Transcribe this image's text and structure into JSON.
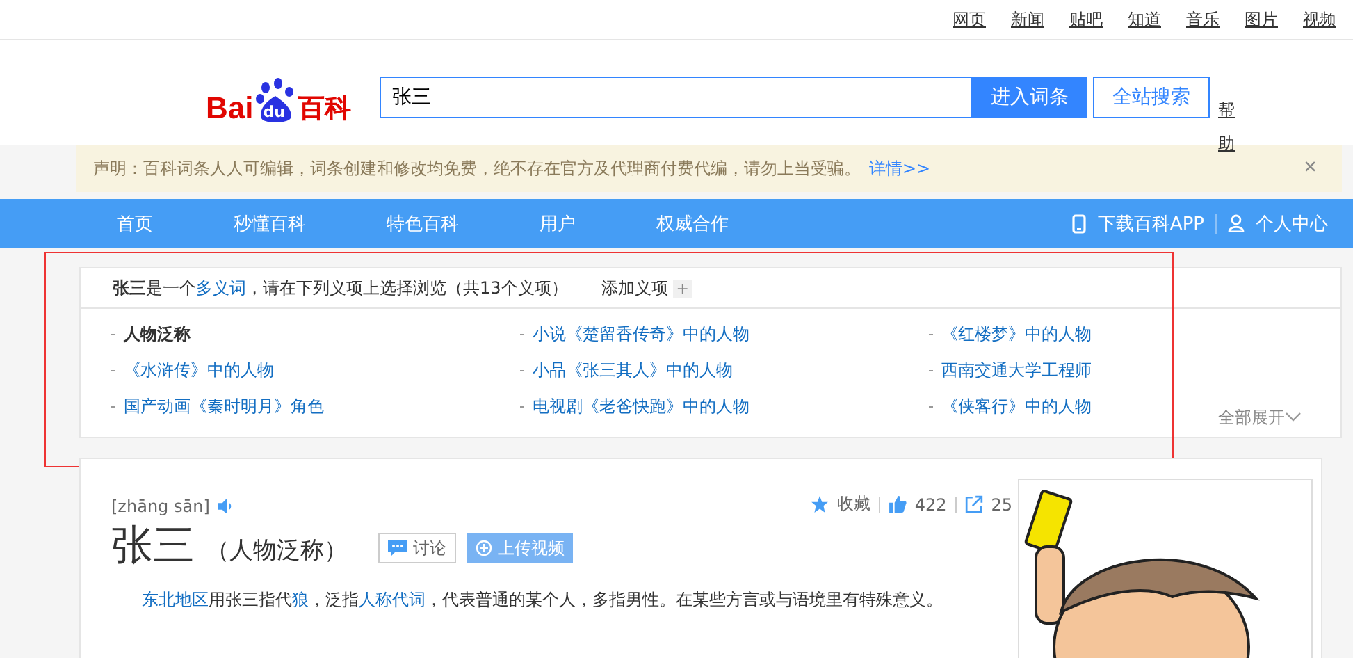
{
  "top_links": [
    "网页",
    "新闻",
    "贴吧",
    "知道",
    "音乐",
    "图片",
    "视频"
  ],
  "logo": {
    "left": "Bai",
    "badge": "du",
    "right": "百科"
  },
  "search": {
    "value": "张三",
    "enter_button": "进入词条",
    "site_button": "全站搜索",
    "help": "帮助"
  },
  "notice": {
    "text": "声明：百科词条人人可编辑，词条创建和修改均免费，绝不存在官方及代理商付费代编，请勿上当受骗。",
    "link": "详情>>",
    "close": "×"
  },
  "nav": {
    "items": [
      "首页",
      "秒懂百科",
      "特色百科",
      "用户",
      "权威合作"
    ],
    "app": "下载百科APP",
    "user": "个人中心"
  },
  "polysemy": {
    "title": "张三",
    "intro": "是一个",
    "intro_link": "多义词",
    "after": "，请在下列义项上选择浏览（共13个义项）",
    "add": "添加义项",
    "add_icon": "+",
    "expand": "全部展开",
    "items": [
      {
        "text": "人物泛称",
        "selected": true
      },
      {
        "text": "小说《楚留香传奇》中的人物",
        "selected": false
      },
      {
        "text": "《红楼梦》中的人物",
        "selected": false
      },
      {
        "text": "《水浒传》中的人物",
        "selected": false
      },
      {
        "text": "小品《张三其人》中的人物",
        "selected": false
      },
      {
        "text": "西南交通大学工程师",
        "selected": false
      },
      {
        "text": "国产动画《秦时明月》角色",
        "selected": false
      },
      {
        "text": "电视剧《老爸快跑》中的人物",
        "selected": false
      },
      {
        "text": "《侠客行》中的人物",
        "selected": false
      }
    ]
  },
  "article": {
    "collect": "收藏",
    "likes": "422",
    "shares": "25",
    "pinyin": "[zhāng sān]",
    "title": "张三",
    "subtitle": "（人物泛称）",
    "discuss": "讨论",
    "upload": "上传视频",
    "summary": [
      {
        "text": "东北地区",
        "kind": "link"
      },
      {
        "text": "用张三指代",
        "kind": "text"
      },
      {
        "text": "狼",
        "kind": "link"
      },
      {
        "text": "，泛指",
        "kind": "text"
      },
      {
        "text": "人称代词",
        "kind": "link"
      },
      {
        "text": "，代表普通的某个人，多指男性。在某些方言或与语境里有特殊意义。",
        "kind": "text"
      }
    ]
  }
}
